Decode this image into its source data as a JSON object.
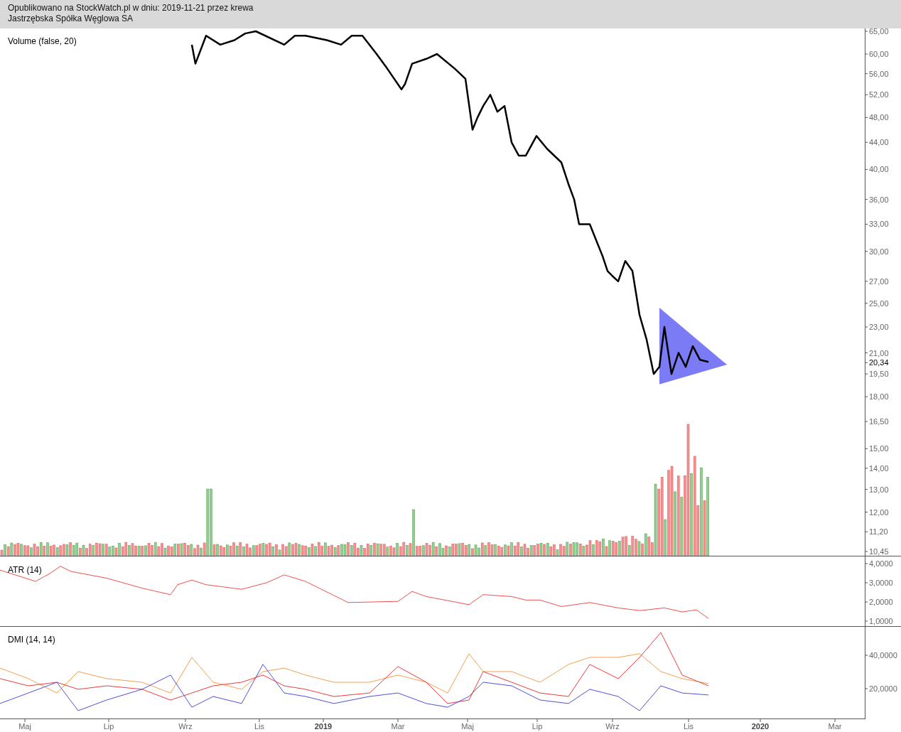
{
  "header": {
    "published_line": "Opublikowano na StockWatch.pl w dniu: 2019-11-21 przez krewa",
    "instrument_name": "Jastrzębska Spółka Węglowa SA"
  },
  "price_pane": {
    "title": "Volume (false, 20)",
    "axis_labels": [
      "65,00",
      "60,00",
      "56,00",
      "52,00",
      "48,00",
      "44,00",
      "40,00",
      "36,00",
      "33,00",
      "30,00",
      "27,00",
      "25,00",
      "23,00",
      "21,00",
      "19,50",
      "18,00",
      "16,50",
      "15,00",
      "14,00",
      "13,00",
      "12,00",
      "11,20",
      "10,45"
    ],
    "last_price_label": "20,34"
  },
  "atr_pane": {
    "title": "ATR (14)",
    "axis_labels": [
      "4,0000",
      "3,0000",
      "2,0000",
      "1,0000"
    ]
  },
  "dmi_pane": {
    "title": "DMI (14, 14)",
    "axis_labels": [
      "40,0000",
      "20,0000"
    ]
  },
  "time_axis": {
    "labels": [
      {
        "kind": "month",
        "label": "Maj"
      },
      {
        "kind": "month",
        "label": "Lip"
      },
      {
        "kind": "month",
        "label": "Wrz"
      },
      {
        "kind": "month",
        "label": "Lis"
      },
      {
        "kind": "year",
        "label": "2019"
      },
      {
        "kind": "month",
        "label": "Mar"
      },
      {
        "kind": "month",
        "label": "Maj"
      },
      {
        "kind": "month",
        "label": "Lip"
      },
      {
        "kind": "month",
        "label": "Wrz"
      },
      {
        "kind": "month",
        "label": "Lis"
      },
      {
        "kind": "year",
        "label": "2020"
      },
      {
        "kind": "month",
        "label": "Mar"
      }
    ]
  }
}
